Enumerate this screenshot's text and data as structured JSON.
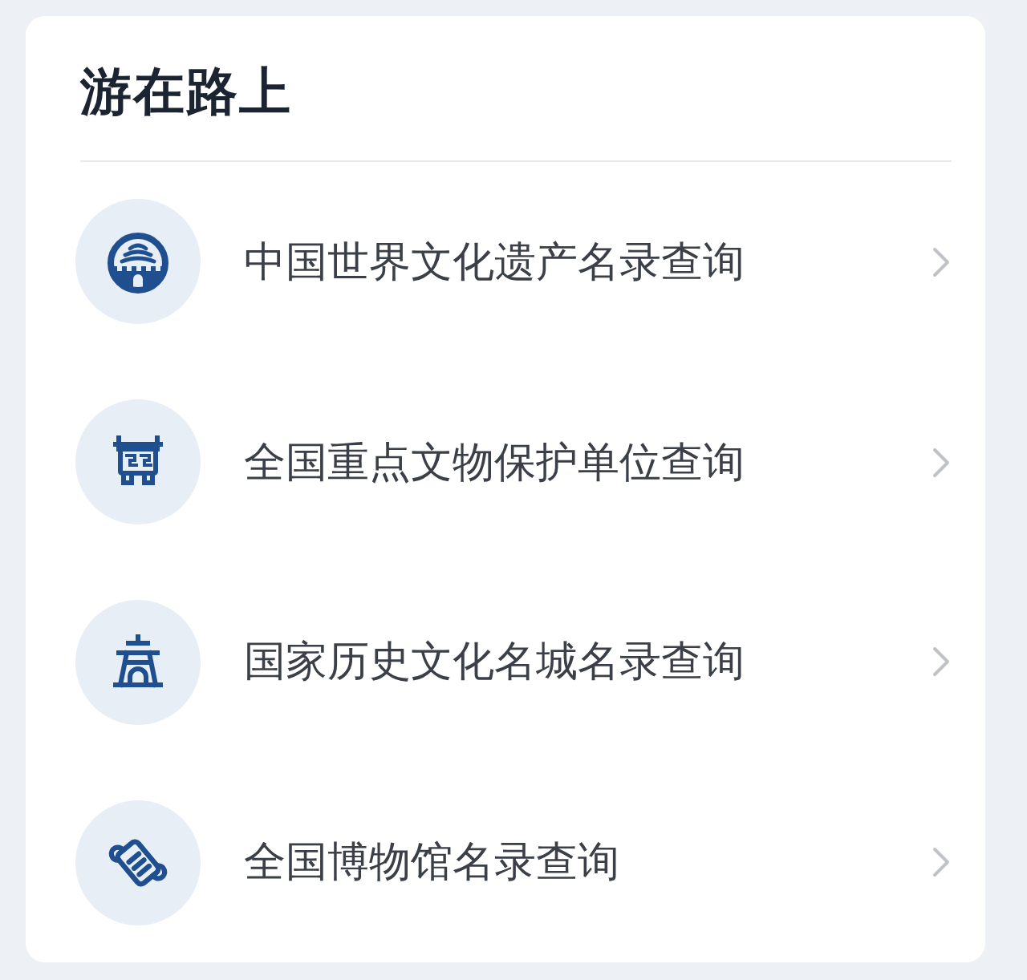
{
  "title": "游在路上",
  "items": [
    {
      "kind": "heritage",
      "label": "中国世界文化遗产名录查询"
    },
    {
      "kind": "relic",
      "label": "全国重点文物保护单位查询"
    },
    {
      "kind": "city",
      "label": "国家历史文化名城名录查询"
    },
    {
      "kind": "museum",
      "label": "全国博物馆名录查询"
    }
  ]
}
